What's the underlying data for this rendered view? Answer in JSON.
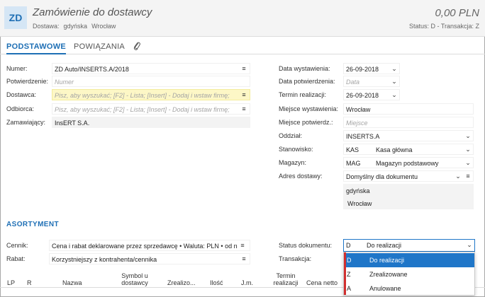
{
  "header": {
    "badge": "ZD",
    "title": "Zamówienie do dostawcy",
    "delivery_label": "Dostawa:",
    "delivery_value1": "gdyńska",
    "delivery_value2": "Wrocław",
    "amount": "0,00 PLN",
    "status_line": "Status: D - Transakcja: Z"
  },
  "tabs": [
    "PODSTAWOWE",
    "POWIĄZANIA"
  ],
  "left": {
    "numer_label": "Numer:",
    "numer_value": "ZD Auto/INSERTS.A/2018",
    "potw_label": "Potwierdzenie:",
    "potw_placeholder": "Numer",
    "dostawca_label": "Dostawca:",
    "dostawca_placeholder": "Pisz, aby wyszukać; [F2] - Lista; [Insert] - Dodaj i wstaw firmę;",
    "odbiorca_label": "Odbiorca:",
    "odbiorca_placeholder": "Pisz, aby wyszukać; [F2] - Lista; [Insert] - Dodaj i wstaw firmę;",
    "zamaw_label": "Zamawiający:",
    "zamaw_value": "InsERT S.A."
  },
  "right": {
    "data_wyst_label": "Data wystawienia:",
    "data_wyst_value": "26-09-2018",
    "data_potw_label": "Data potwierdzenia:",
    "data_potw_placeholder": "Data",
    "termin_label": "Termin realizacji:",
    "termin_value": "26-09-2018",
    "miejsce_label": "Miejsce wystawienia:",
    "miejsce_value": "Wrocław",
    "miejsce_potw_label": "Miejsce potwierdz.:",
    "miejsce_potw_placeholder": "Miejsce",
    "oddzial_label": "Oddział:",
    "oddzial_value": "INSERTS.A",
    "stanowisko_label": "Stanowisko:",
    "stanowisko_code": "KAS",
    "stanowisko_value": "Kasa główna",
    "magazyn_label": "Magazyn:",
    "magazyn_code": "MAG",
    "magazyn_value": "Magazyn podstawowy",
    "adres_label": "Adres dostawy:",
    "adres_value": "Domyślny dla dokumentu",
    "adres_line1": "gdyńska",
    "adres_line2": "Wrocław"
  },
  "section_title": "ASORTYMENT",
  "bottom": {
    "cennik_label": "Cennik:",
    "cennik_value": "Cena i rabat deklarowane przez sprzedawcę • Waluta: PLN • od n",
    "rabat_label": "Rabat:",
    "rabat_value": "Korzystniejszy z kontrahenta/cennika",
    "status_label": "Status dokumentu:",
    "status_code": "D",
    "status_value": "Do realizacji",
    "transakcja_label": "Transakcja:"
  },
  "status_options": [
    {
      "code": "D",
      "label": "Do realizacji"
    },
    {
      "code": "Z",
      "label": "Zrealizowane"
    },
    {
      "code": "A",
      "label": "Anulowane"
    }
  ],
  "grid_columns": [
    "LP",
    "R",
    "Nazwa",
    "Symbol u dostawcy",
    "Zrealizo...",
    "Ilość",
    "J.m.",
    "Termin realizacji",
    "Cena netto"
  ],
  "icons": {
    "menu": "hamburger-icon",
    "chevron": "chevron-down-icon",
    "clip": "paperclip-icon"
  }
}
